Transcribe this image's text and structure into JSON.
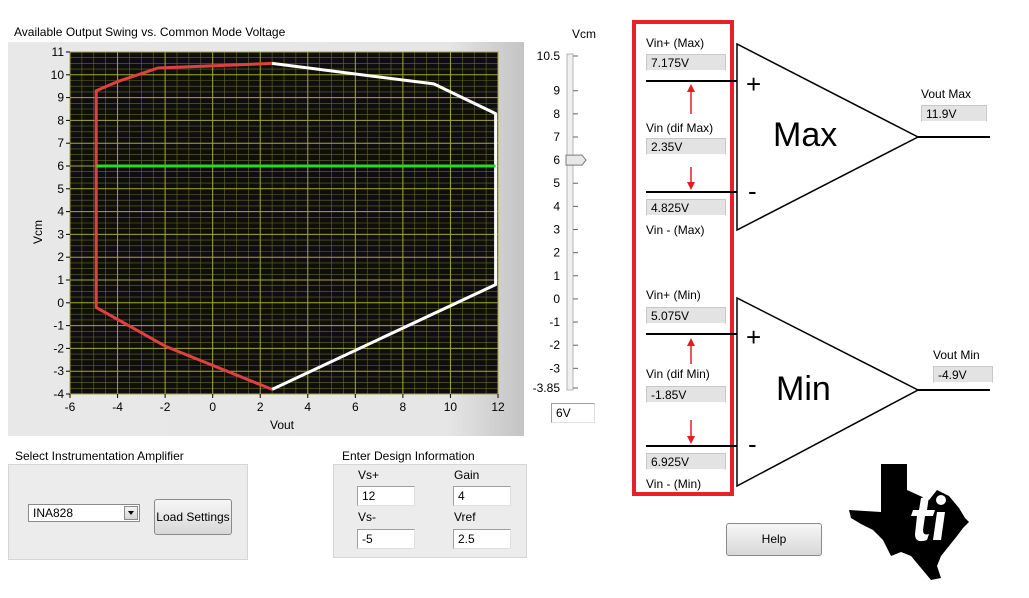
{
  "chart_data": {
    "type": "line",
    "title": "Available Output Swing vs. Common Mode Voltage",
    "xlabel": "Vout",
    "ylabel": "Vcm",
    "xlim": [
      -6,
      12
    ],
    "ylim": [
      -4,
      11
    ],
    "x_ticks": [
      -6,
      -4,
      -2,
      0,
      2,
      4,
      6,
      8,
      10,
      12
    ],
    "y_ticks": [
      11,
      10,
      9,
      8,
      7,
      6,
      5,
      4,
      3,
      2,
      1,
      0,
      -1,
      -2,
      -3,
      -4
    ],
    "grid": true,
    "series": [
      {
        "color": "#e04040",
        "points": [
          [
            2.5,
            10.5
          ],
          [
            -2.3,
            10.3
          ],
          [
            -4.0,
            9.7
          ],
          [
            -4.9,
            9.3
          ],
          [
            -4.9,
            -0.2
          ],
          [
            -2.0,
            -1.9
          ],
          [
            2.5,
            -3.8
          ]
        ]
      },
      {
        "color": "#ffffff",
        "points": [
          [
            2.5,
            10.5
          ],
          [
            9.3,
            9.6
          ],
          [
            11.9,
            8.3
          ],
          [
            11.9,
            0.8
          ],
          [
            2.5,
            -3.8
          ]
        ]
      },
      {
        "color": "#22dd22",
        "points": [
          [
            -4.9,
            6
          ],
          [
            11.9,
            6
          ]
        ]
      }
    ]
  },
  "slider": {
    "title": "Vcm",
    "max_label": "10.5",
    "min_label": "-3.85",
    "tick_labels": [
      "9",
      "8",
      "7",
      "6",
      "5",
      "4",
      "3",
      "2",
      "1",
      "0",
      "-1",
      "-2",
      "-3"
    ],
    "value": 6,
    "readout": "6V"
  },
  "amplifier_select": {
    "title": "Select Instrumentation Amplifier",
    "selected": "INA828",
    "load_button": "Load Settings"
  },
  "design_info": {
    "title": "Enter Design Information",
    "vs_plus_label": "Vs+",
    "vs_plus_value": "12",
    "gain_label": "Gain",
    "gain_value": "4",
    "vs_minus_label": "Vs-",
    "vs_minus_value": "-5",
    "vref_label": "Vref",
    "vref_value": "2.5"
  },
  "max_block": {
    "vin_plus_label": "Vin+ (Max)",
    "vin_plus_value": "7.175V",
    "vin_dif_label": "Vin (dif Max)",
    "vin_dif_value": "2.35V",
    "vin_minus_value": "4.825V",
    "vin_minus_label": "Vin - (Max)",
    "amp_label": "Max",
    "plus_sign": "+",
    "minus_sign": "-",
    "vout_label": "Vout Max",
    "vout_value": "11.9V"
  },
  "min_block": {
    "vin_plus_label": "Vin+ (Min)",
    "vin_plus_value": "5.075V",
    "vin_dif_label": "Vin (dif Min)",
    "vin_dif_value": "-1.85V",
    "vin_minus_value": "6.925V",
    "vin_minus_label": "Vin - (Min)",
    "amp_label": "Min",
    "plus_sign": "+",
    "minus_sign": "-",
    "vout_label": "Vout Min",
    "vout_value": "-4.9V"
  },
  "help_button": "Help",
  "colors": {
    "highlight_border": "#e8202a",
    "plot_bg": "#0e0e0e",
    "grid": "#9a9a2a",
    "arrow": "#e02020"
  }
}
